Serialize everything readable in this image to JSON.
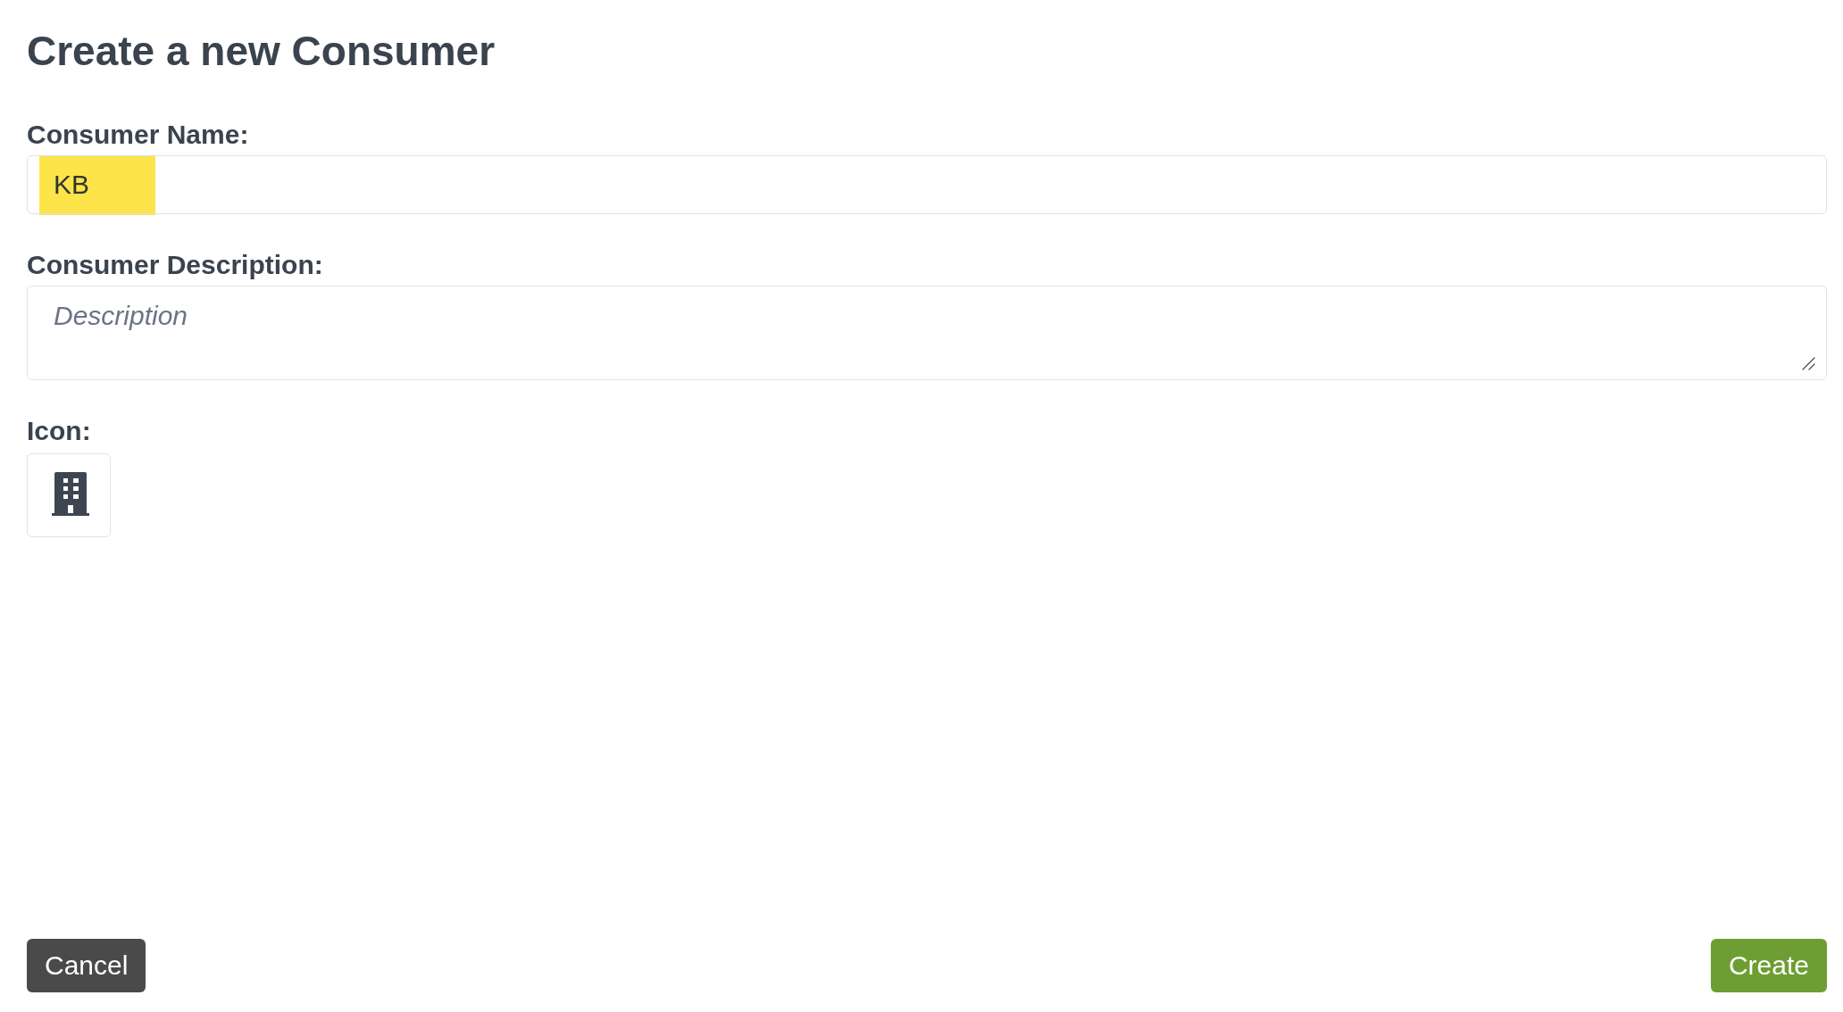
{
  "heading": "Create a new Consumer",
  "fields": [
    {
      "kind": "text",
      "label": "Consumer Name:",
      "value": "KB",
      "highlighted": true
    },
    {
      "kind": "textarea",
      "label": "Consumer Description:",
      "placeholder": "Description"
    },
    {
      "kind": "icon",
      "label": "Icon:"
    }
  ],
  "buttons": [
    {
      "kind": "secondary",
      "label": "Cancel"
    },
    {
      "kind": "primary",
      "label": "Create"
    }
  ]
}
